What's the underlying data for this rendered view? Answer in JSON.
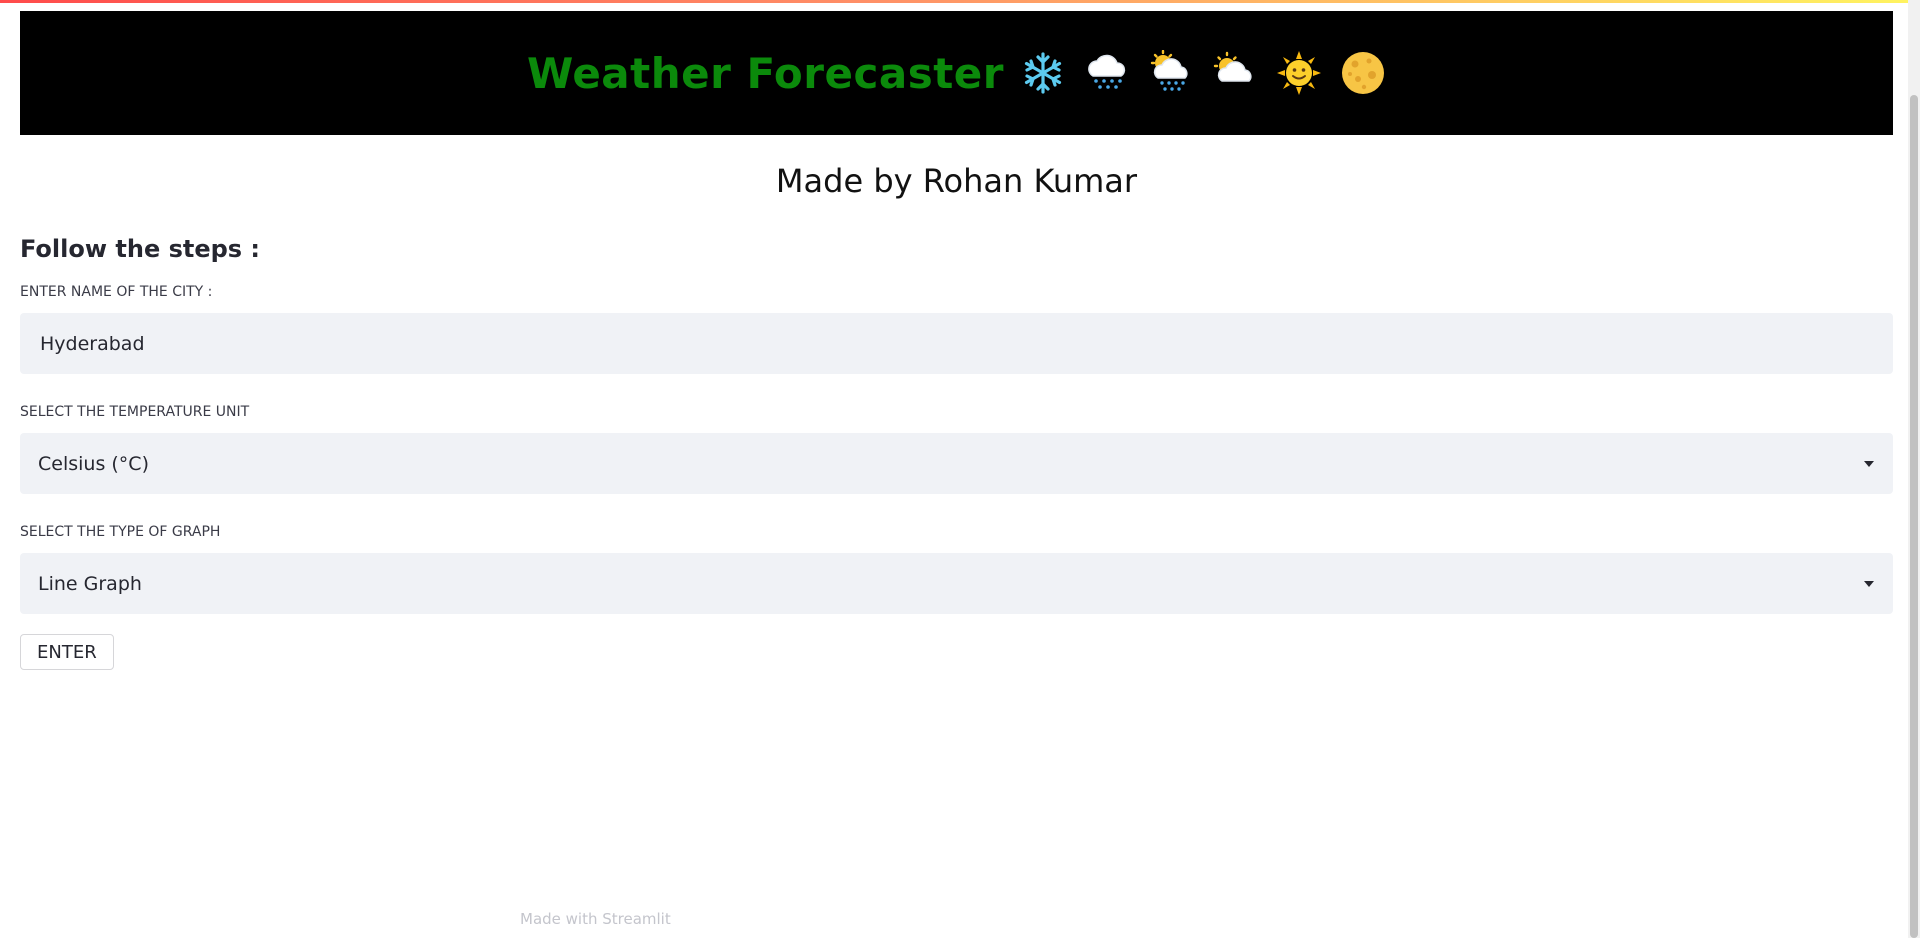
{
  "app": {
    "title": "Weather Forecaster",
    "accent_color": "#0b8a0b",
    "banner_background": "#000000",
    "weather_icons": [
      "snowflake-icon",
      "snow-cloud-icon",
      "sun-behind-rain-cloud-icon",
      "sun-behind-cloud-icon",
      "sun-with-face-icon",
      "full-moon-icon"
    ]
  },
  "byline": "Made by Rohan Kumar",
  "steps_heading": "Follow the steps :",
  "form": {
    "city": {
      "label": "ENTER NAME OF THE CITY :",
      "value": "Hyderabad"
    },
    "unit": {
      "label": "SELECT THE TEMPERATURE UNIT",
      "selected": "Celsius (°C)"
    },
    "graph": {
      "label": "SELECT THE TYPE OF GRAPH",
      "selected": "Line Graph"
    },
    "submit_label": "ENTER"
  },
  "footer": {
    "text": "Made with Streamlit"
  },
  "menu_icon": "hamburger-menu-icon"
}
